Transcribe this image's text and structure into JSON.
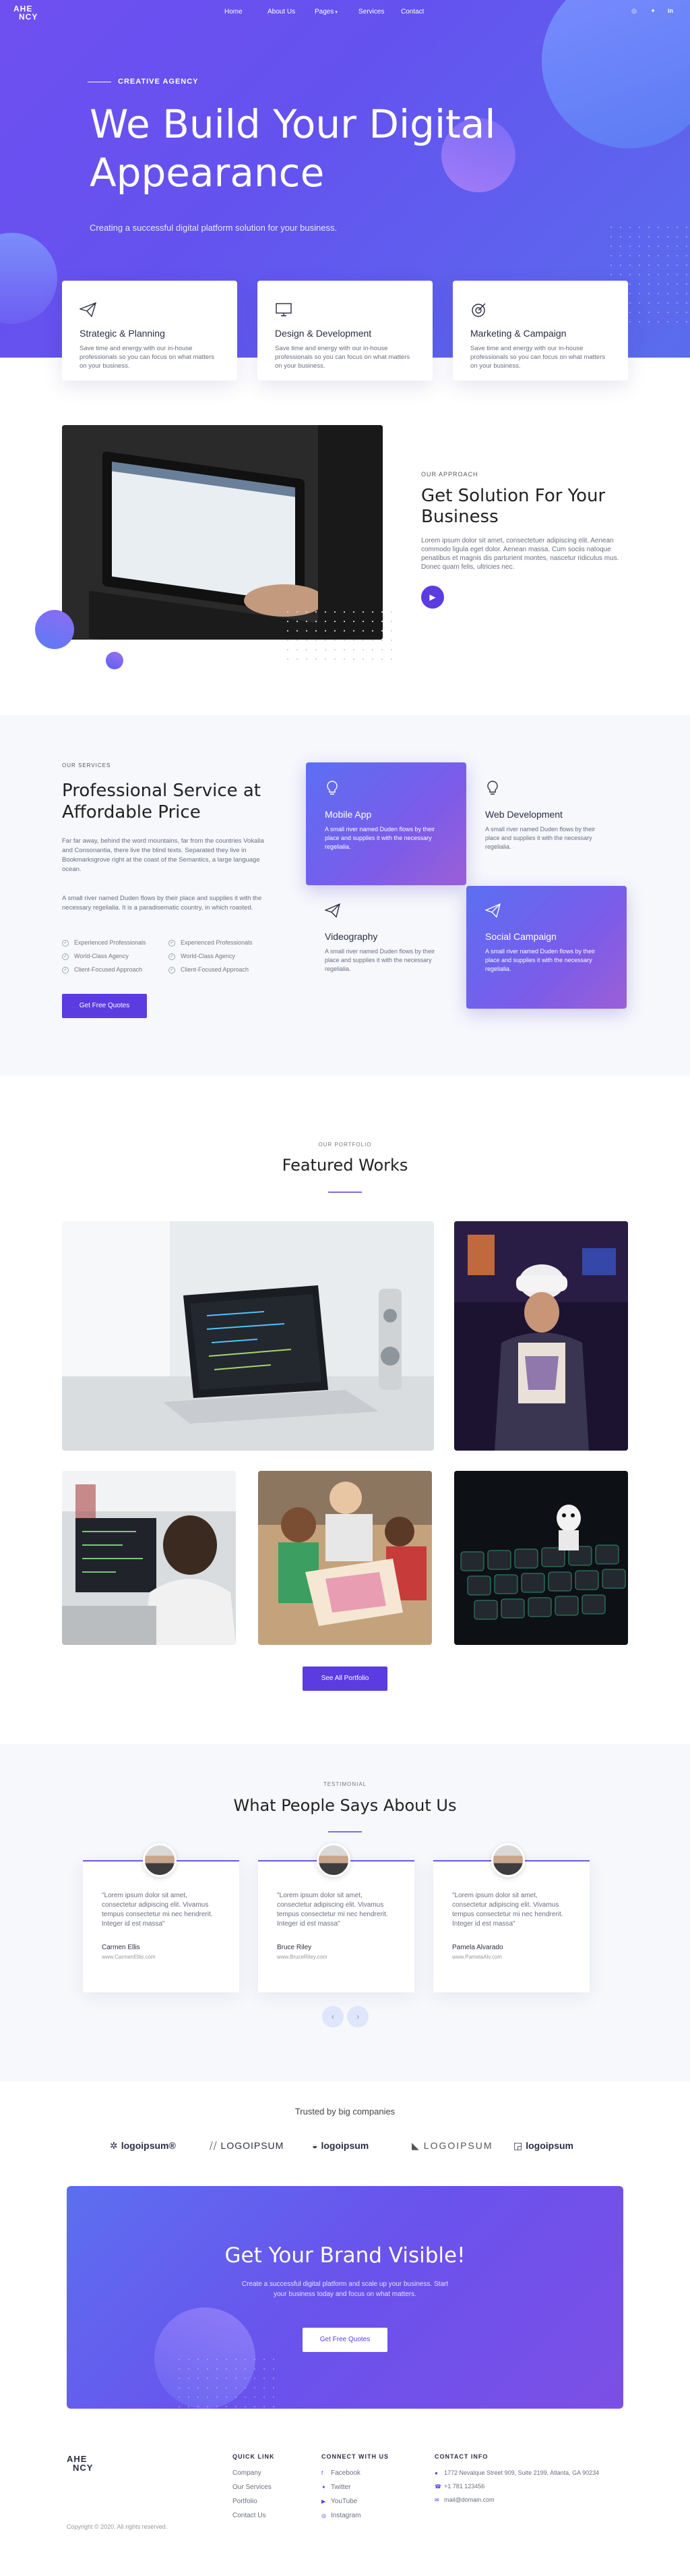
{
  "brand": {
    "line1": "AHE",
    "line2": "NCY"
  },
  "nav": {
    "items": [
      "Home",
      "About Us",
      "Pages",
      "Services",
      "Contact"
    ]
  },
  "hero": {
    "tagline": "CREATIVE AGENCY",
    "title_line1": "We Build Your Digital",
    "title_line2": "Appearance",
    "subtitle": "Creating a successful digital platform solution for your business."
  },
  "features": [
    {
      "icon": "paper-plane-icon",
      "title": "Strategic & Planning",
      "text": "Save time and energy with our in-house professionals so you can focus on what matters on your business."
    },
    {
      "icon": "monitor-icon",
      "title": "Design & Development",
      "text": "Save time and energy with our in-house professionals so you can focus on what matters on your business."
    },
    {
      "icon": "target-icon",
      "title": "Marketing & Campaign",
      "text": "Save time and energy with our in-house professionals so you can focus on what matters on your business."
    }
  ],
  "approach": {
    "eyebrow": "OUR APPROACH",
    "title_line1": "Get Solution For Your",
    "title_line2": "Business",
    "text": "Lorem ipsum dolor sit amet, consectetuer adipiscing elit. Aenean commodo ligula eget dolor. Aenean massa. Cum sociis natoque penatibus et magnis dis parturient montes, nascetur ridiculus mus. Donec quam felis, ultricies nec."
  },
  "services": {
    "eyebrow": "OUR SERVICES",
    "title_line1": "Professional Service at",
    "title_line2": "Affordable Price",
    "text1": "Far far away, behind the word mountains, far from the countries Vokalia and Consonantia, there live the blind texts. Separated they live in Bookmarksgrove right at the coast of the Semantics, a large language ocean.",
    "text2": "A small river named Duden flows by their place and supplies it with the necessary regelialia. It is a paradisematic country, in which roasted.",
    "checks": [
      "Experienced Professionals",
      "World-Class Agency",
      "Client-Focused Approach",
      "Experienced Professionals",
      "World-Class Agency",
      "Client-Focused Approach"
    ],
    "button": "Get Free Quotes",
    "cards": [
      {
        "icon": "bulb-icon",
        "title": "Mobile App",
        "text": "A small river named Duden flows by their place and supplies it with the necessary regelialia."
      },
      {
        "icon": "bulb-icon",
        "title": "Web Development",
        "text": "A small river named Duden flows by their place and supplies it with the necessary regelialia."
      },
      {
        "icon": "paper-plane-icon",
        "title": "Videography",
        "text": "A small river named Duden flows by their place and supplies it with the necessary regelialia."
      },
      {
        "icon": "paper-plane-icon",
        "title": "Social Campaign",
        "text": "A small river named Duden flows by their place and supplies it with the necessary regelialia."
      }
    ]
  },
  "portfolio": {
    "eyebrow": "OUR PORTFOLIO",
    "title": "Featured Works",
    "button": "See All Portfolio"
  },
  "testimonials": {
    "eyebrow": "TESTIMONIAL",
    "title": "What People Says About Us",
    "items": [
      {
        "quote": "\"Lorem ipsum dolor sit amet, consectetur adipiscing elit. Vivamus tempus consectetur mi nec hendrerit. Integer id est massa\"",
        "name": "Carmen Ellis",
        "site": "www.CarmenEllis.com"
      },
      {
        "quote": "\"Lorem ipsum dolor sit amet, consectetur adipiscing elit. Vivamus tempus consectetur mi nec hendrerit. Integer id est massa\"",
        "name": "Bruce Riley",
        "site": "www.BruceRiley.com"
      },
      {
        "quote": "\"Lorem ipsum dolor sit amet, consectetur adipiscing elit. Vivamus tempus consectetur mi nec hendrerit. Integer id est massa\"",
        "name": "Pamela Alvarado",
        "site": "www.PamelaAlv.com"
      }
    ],
    "prev": "‹",
    "next": "›"
  },
  "clients": {
    "title": "Trusted by big companies",
    "logos": [
      "logoipsum®",
      "LOGOIPSUM",
      "logoipsum",
      "LOGOIPSUM",
      "logoipsum"
    ]
  },
  "cta": {
    "title": "Get Your Brand Visible!",
    "text": "Create a successful digital platform and scale up your business. Start your business today and focus on what matters.",
    "button": "Get Free Quotes"
  },
  "footer": {
    "copyright": "Copyright © 2020. All rights reserved.",
    "quicklink_title": "QUICK LINK",
    "quicklinks": [
      "Company",
      "Our Services",
      "Portfolio",
      "Contact Us"
    ],
    "connect_title": "CONNECT WITH US",
    "connect": [
      "Facebook",
      "Twitter",
      "YouTube",
      "Instagram"
    ],
    "contact_title": "CONTACT INFO",
    "contact": [
      "1772 Nevalque Street 909, Suite 2199, Atlanta, GA 90234",
      "+1 781 123456",
      "mail@domain.com"
    ]
  },
  "colors": {
    "primary": "#5b3ce0",
    "hero_start": "#6f4ff0",
    "hero_end": "#5a6ded",
    "section_bg": "#f6f8fc"
  }
}
